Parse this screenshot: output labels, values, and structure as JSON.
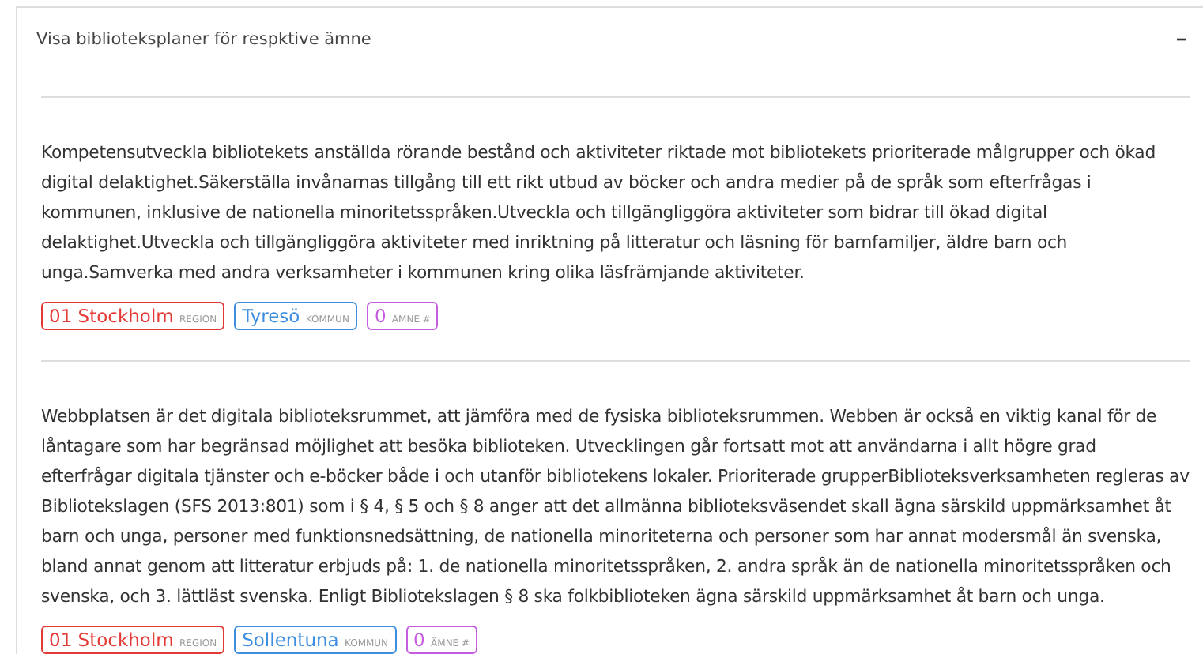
{
  "panel": {
    "title": "Visa biblioteksplaner för respktive ämne",
    "toggle": "−"
  },
  "entries": [
    {
      "text": "Kompetensutveckla bibliotekets anställda rörande bestånd och aktiviteter riktade mot bibliotekets prioriterade målgrupper och ökad digital delaktighet.Säkerställa invånarnas tillgång till ett rikt utbud av böcker och andra medier på de språk som efterfrågas i kommunen, inklusive de nationella minoritetsspråken.Utveckla och tillgängliggöra aktiviteter som bidrar till ökad digital delaktighet.Utveckla och tillgängliggöra aktiviteter med inriktning på litteratur och läsning för barnfamiljer, äldre barn och unga.Samverka med andra verksamheter i kommunen kring olika läsfrämjande aktiviteter.",
      "tags": [
        {
          "value": "01 Stockholm",
          "label": "REGION",
          "color": "#e53935"
        },
        {
          "value": "Tyresö",
          "label": "KOMMUN",
          "color": "#3d8ee0"
        },
        {
          "value": "0",
          "label": "ÄMNE #",
          "color": "#c65de0"
        }
      ]
    },
    {
      "text": "Webbplatsen är det digitala biblioteksrummet, att jämföra med de fysiska biblioteksrummen. Webben är också en viktig kanal för de låntagare som har begränsad möjlighet att besöka biblioteken. Utvecklingen går fortsatt mot att användarna i allt högre grad efterfrågar digitala tjänster och e-böcker både i och utanför bibliotekens lokaler. Prioriterade grupperBiblioteksverksamheten regleras av Bibliotekslagen (SFS 2013:801) som i § 4, § 5 och § 8 anger att det allmänna biblioteksväsendet skall ägna särskild uppmärksamhet åt barn och unga, personer med funktionsnedsättning, de nationella minoriteterna och personer som har annat modersmål än svenska, bland annat genom att litteratur erbjuds på: 1. de nationella minoritetsspråken, 2. andra språk än de nationella minoritetsspråken och svenska, och 3. lättläst svenska. Enligt Bibliotekslagen § 8 ska folkbiblioteken ägna särskild uppmärksamhet åt barn och unga.",
      "tags": [
        {
          "value": "01 Stockholm",
          "label": "REGION",
          "color": "#e53935"
        },
        {
          "value": "Sollentuna",
          "label": "KOMMUN",
          "color": "#3d8ee0"
        },
        {
          "value": "0",
          "label": "ÄMNE #",
          "color": "#c65de0"
        }
      ]
    }
  ]
}
